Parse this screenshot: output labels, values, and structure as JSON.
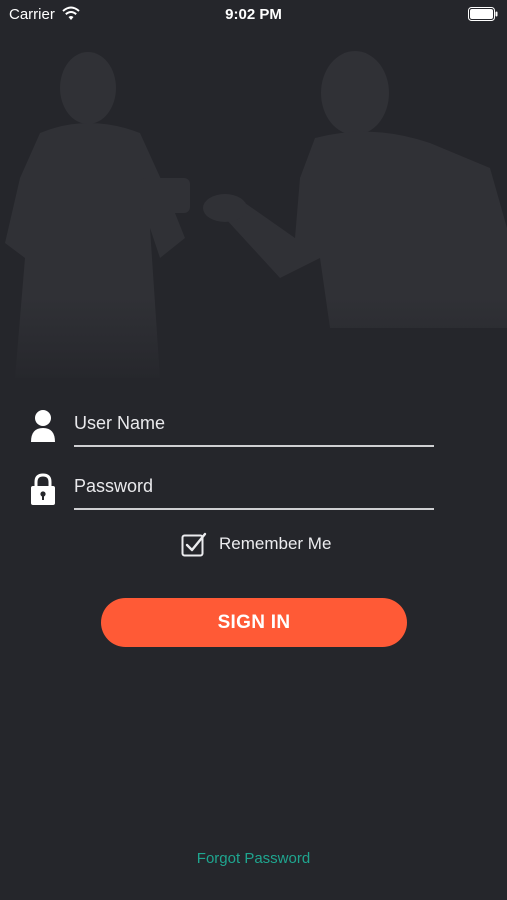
{
  "status_bar": {
    "carrier": "Carrier",
    "time": "9:02 PM",
    "wifi_icon": "wifi-icon",
    "battery_icon": "battery-icon"
  },
  "hero": {
    "image": "medical-staff-background-photo"
  },
  "login": {
    "username_placeholder": "User Name",
    "username_value": "",
    "username_icon": "user-icon",
    "password_placeholder": "Password",
    "password_value": "",
    "password_icon": "lock-icon",
    "remember_label": "Remember Me",
    "remember_checked": true,
    "signin_label": "SIGN IN",
    "forgot_label": "Forgot Password"
  },
  "colors": {
    "background": "#25262b",
    "accent": "#ff5a36",
    "link": "#1fa58f",
    "text": "#ffffff"
  }
}
